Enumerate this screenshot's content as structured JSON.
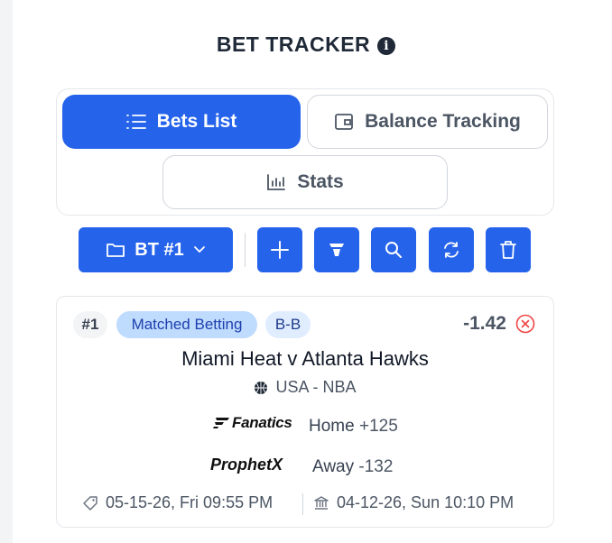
{
  "header": {
    "title": "BET TRACKER",
    "info_icon": "info-icon",
    "info_glyph": "i"
  },
  "tabs": [
    {
      "label": "Bets List",
      "icon": "list-icon",
      "active": true
    },
    {
      "label": "Balance Tracking",
      "icon": "wallet-icon",
      "active": false
    },
    {
      "label": "Stats",
      "icon": "bar-chart-icon",
      "active": false
    }
  ],
  "toolbar": {
    "tracker_select": "BT #1",
    "buttons": [
      "add-icon",
      "filter-icon",
      "search-icon",
      "refresh-icon",
      "trash-icon"
    ]
  },
  "colors": {
    "primary": "#2563eb",
    "danger": "#ef4444",
    "badge_blue": "#bfdbfe"
  },
  "bet": {
    "number": "#1",
    "type": "Matched Betting",
    "code": "B-B",
    "profit": "-1.42",
    "event": "Miami Heat v Atlanta Hawks",
    "league": "USA - NBA",
    "legs": [
      {
        "bookmaker": "Fanatics",
        "selection": "Home",
        "odds": "+125"
      },
      {
        "bookmaker": "ProphetX",
        "selection": "Away",
        "odds": "-132"
      }
    ],
    "placed_date": "05-15-26, Fri 09:55 PM",
    "event_date": "04-12-26, Sun 10:10 PM"
  }
}
